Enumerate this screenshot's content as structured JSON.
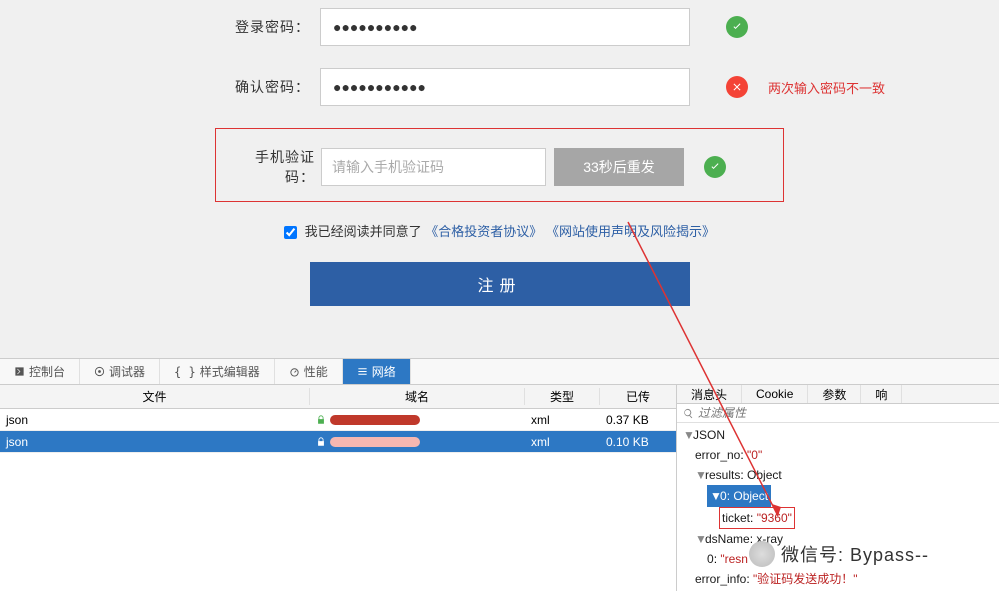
{
  "form": {
    "password_label": "登录密码：",
    "password_value": "●●●●●●●●●●",
    "confirm_label": "确认密码：",
    "confirm_value": "●●●●●●●●●●●",
    "confirm_error": "两次输入密码不一致",
    "sms_label": "手机验证码：",
    "sms_placeholder": "请输入手机验证码",
    "resend_label": "33秒后重发",
    "agree_prefix": "我已经阅读并同意了",
    "agree_link1": "《合格投资者协议》",
    "agree_link2": "《网站使用声明及风险揭示》",
    "register_label": "注册"
  },
  "devtools": {
    "tabs": {
      "console": "控制台",
      "debugger": "调试器",
      "style": "样式编辑器",
      "perf": "性能",
      "network": "网络"
    },
    "net_headers": {
      "file": "文件",
      "domain": "域名",
      "type": "类型",
      "size": "已传"
    },
    "rows": [
      {
        "file": "json",
        "type": "xml",
        "size": "0.37 KB"
      },
      {
        "file": "json",
        "type": "xml",
        "size": "0.10 KB"
      }
    ],
    "inspect_tabs": {
      "headers": "消息头",
      "cookie": "Cookie",
      "params": "参数",
      "resp": "响"
    },
    "filter_placeholder": "过滤属性",
    "tree": {
      "root": "JSON",
      "error_no": "error_no",
      "error_no_val": "\"0\"",
      "results": "results",
      "results_val": "Object",
      "zero": "0",
      "zero_val": "Object",
      "ticket": "ticket",
      "ticket_val": "\"9360\"",
      "dsname": "dsName",
      "dsname_val": "x-ray",
      "zero2": "0",
      "resn": "\"resn",
      "error_info": "error_info",
      "error_info_val": "\"验证码发送成功！\""
    }
  },
  "watermark": "微信号: Bypass--"
}
